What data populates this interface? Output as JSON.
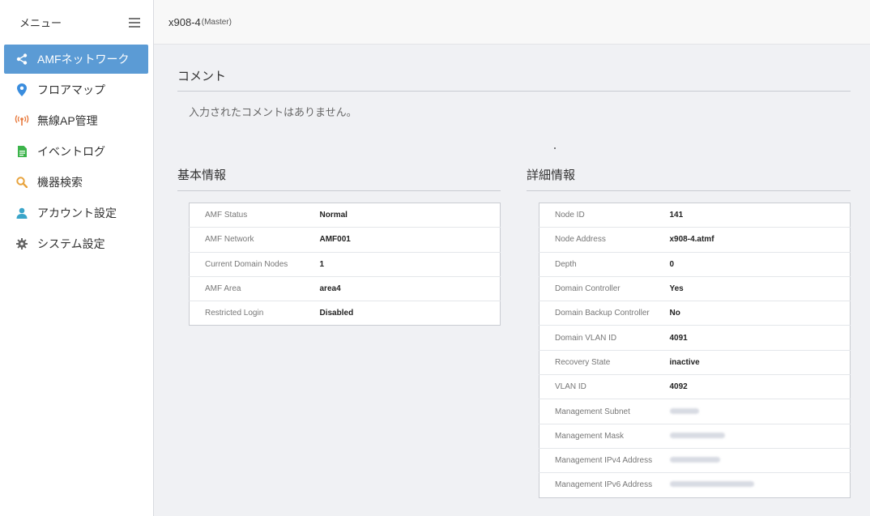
{
  "sidebar": {
    "title": "メニュー",
    "items": [
      {
        "label": "AMFネットワーク",
        "icon": "share-icon",
        "active": true
      },
      {
        "label": "フロアマップ",
        "icon": "map-pin-icon",
        "active": false
      },
      {
        "label": "無線AP管理",
        "icon": "wireless-ap-icon",
        "active": false
      },
      {
        "label": "イベントログ",
        "icon": "document-icon",
        "active": false
      },
      {
        "label": "機器検索",
        "icon": "search-icon",
        "active": false
      },
      {
        "label": "アカウント設定",
        "icon": "user-icon",
        "active": false
      },
      {
        "label": "システム設定",
        "icon": "gear-icon",
        "active": false
      }
    ]
  },
  "topbar": {
    "node_name": "x908-4",
    "node_role": "(Master)"
  },
  "comment": {
    "title": "コメント",
    "text": "入力されたコメントはありません。"
  },
  "basic": {
    "title": "基本情報",
    "rows": [
      {
        "key": "AMF Status",
        "value": "Normal"
      },
      {
        "key": "AMF Network",
        "value": "AMF001"
      },
      {
        "key": "Current Domain Nodes",
        "value": "1"
      },
      {
        "key": "AMF Area",
        "value": "area4"
      },
      {
        "key": "Restricted Login",
        "value": "Disabled"
      }
    ]
  },
  "detail": {
    "title": "詳細情報",
    "rows": [
      {
        "key": "Node ID",
        "value": "141"
      },
      {
        "key": "Node Address",
        "value": "x908-4.atmf"
      },
      {
        "key": "Depth",
        "value": "0"
      },
      {
        "key": "Domain Controller",
        "value": "Yes"
      },
      {
        "key": "Domain Backup Controller",
        "value": "No"
      },
      {
        "key": "Domain VLAN ID",
        "value": "4091"
      },
      {
        "key": "Recovery State",
        "value": "inactive"
      },
      {
        "key": "VLAN ID",
        "value": "4092"
      },
      {
        "key": "Management Subnet",
        "value": ""
      },
      {
        "key": "Management Mask",
        "value": ""
      },
      {
        "key": "Management IPv4 Address",
        "value": ""
      },
      {
        "key": "Management IPv6 Address",
        "value": ""
      }
    ]
  },
  "colors": {
    "accent": "#5b9bd5",
    "background": "#f0f1f4"
  }
}
